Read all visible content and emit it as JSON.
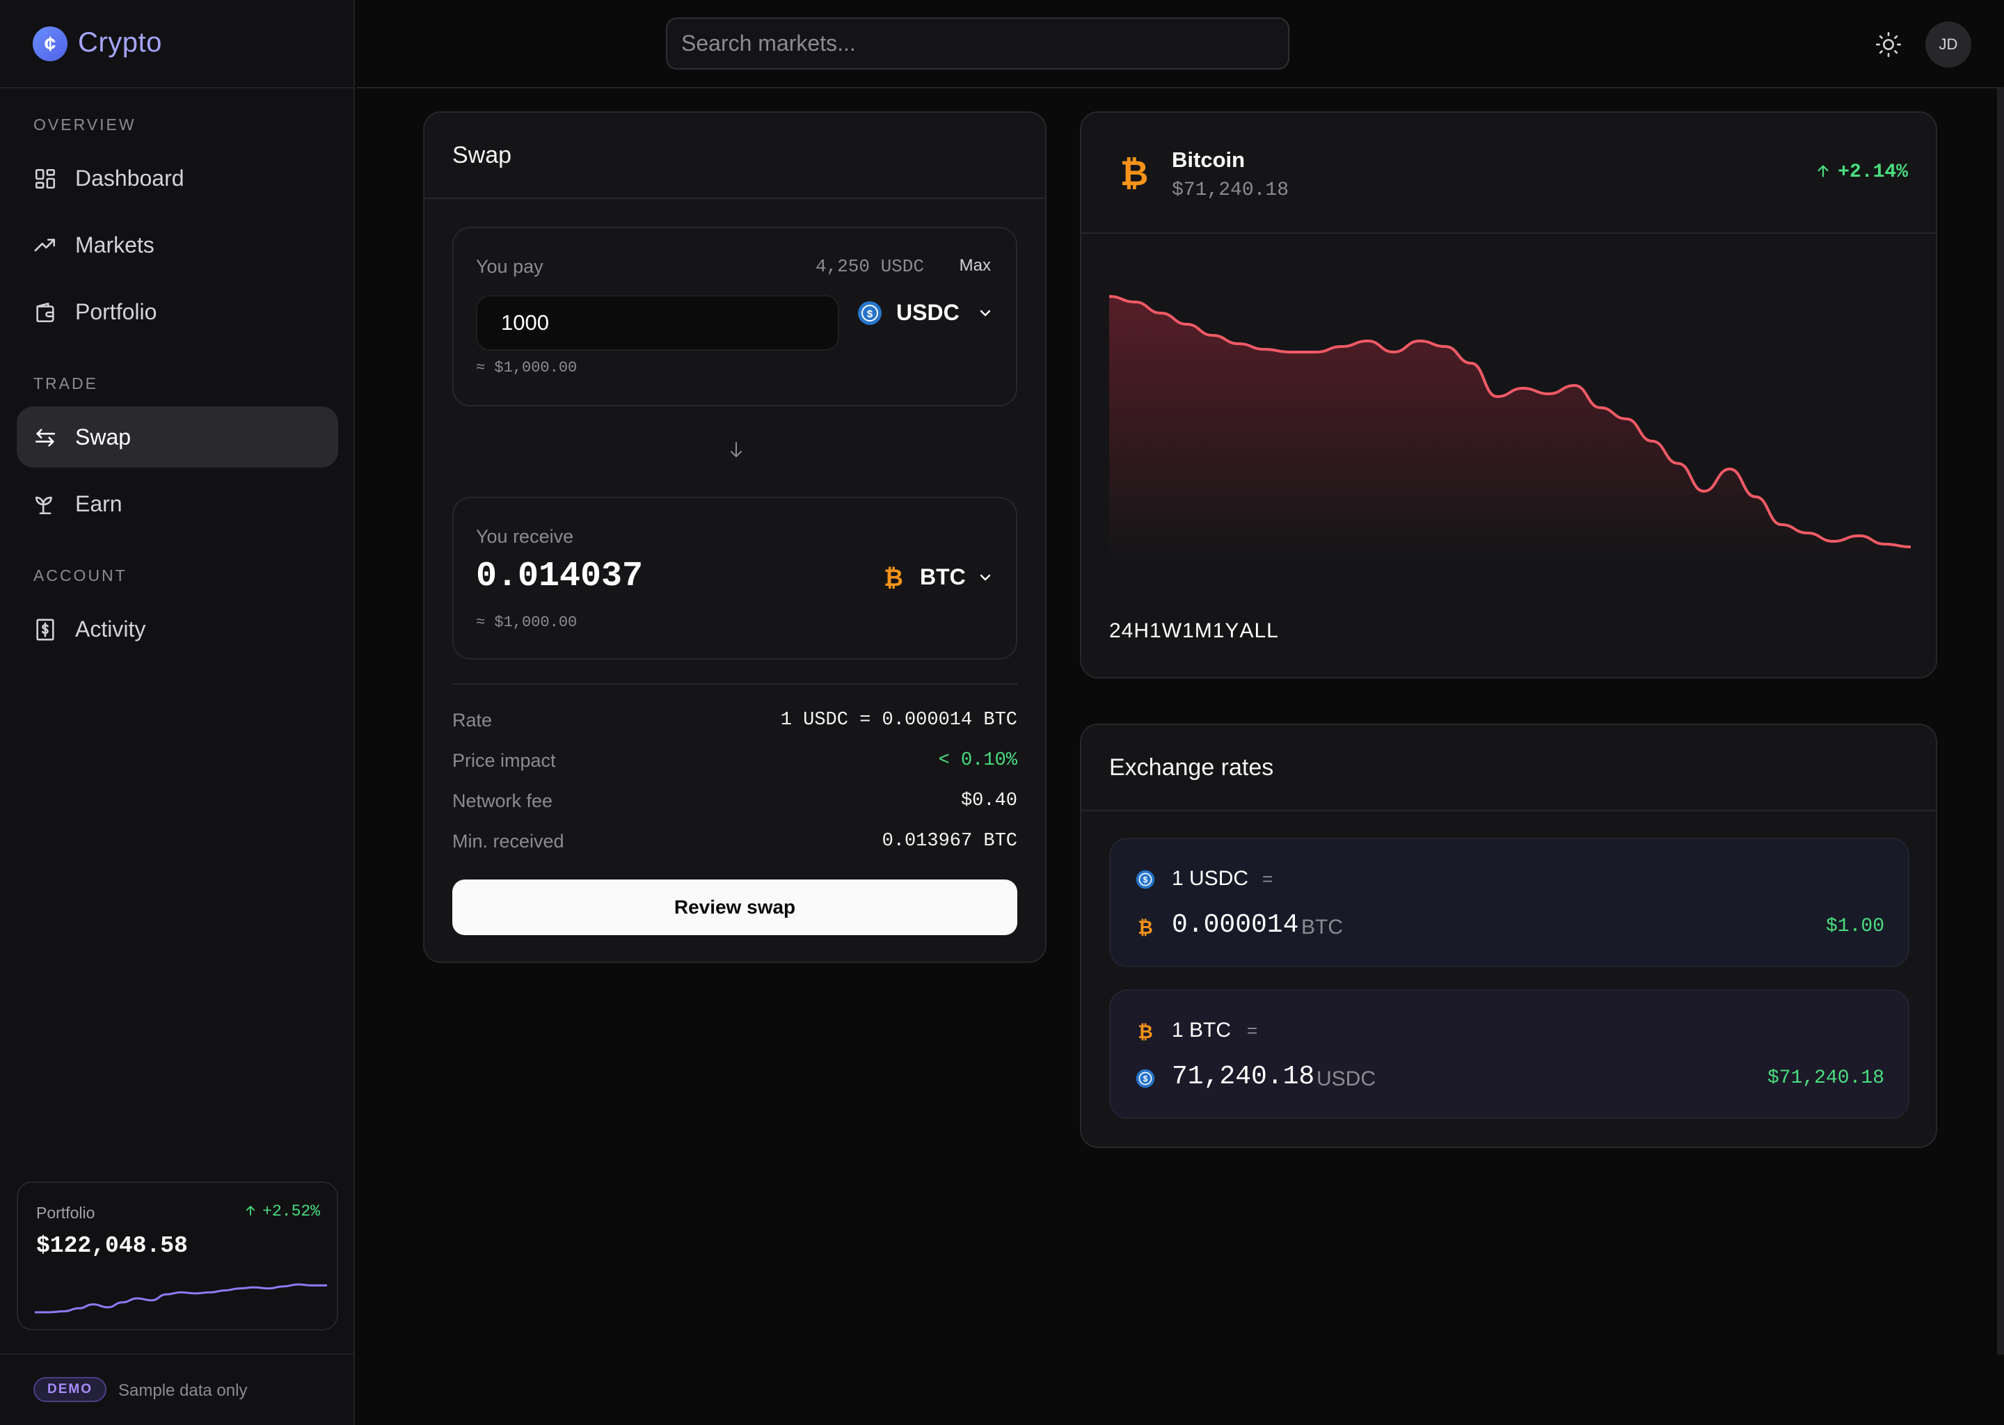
{
  "brand": {
    "name": "Crypto"
  },
  "search": {
    "placeholder": "Search markets..."
  },
  "user": {
    "initials": "JD"
  },
  "sidebar": {
    "sections": [
      "OVERVIEW",
      "TRADE",
      "ACCOUNT"
    ],
    "items": [
      {
        "label": "Dashboard",
        "icon": "dashboard-icon"
      },
      {
        "label": "Markets",
        "icon": "trending-up-icon"
      },
      {
        "label": "Portfolio",
        "icon": "wallet-icon"
      },
      {
        "label": "Swap",
        "icon": "swap-icon",
        "active": true
      },
      {
        "label": "Earn",
        "icon": "sprout-icon"
      },
      {
        "label": "Activity",
        "icon": "receipt-icon"
      }
    ],
    "portfolio": {
      "label": "Portfolio",
      "change": "+2.52%",
      "value": "$122,048.58",
      "sparkline": [
        20,
        20,
        21,
        24,
        28,
        25,
        30,
        34,
        32,
        38,
        40,
        39,
        40,
        42,
        44,
        45,
        44,
        46,
        48,
        47,
        47
      ]
    },
    "demo": {
      "badge": "DEMO",
      "note": "Sample data only"
    }
  },
  "swap": {
    "title": "Swap",
    "pay": {
      "label": "You pay",
      "balance": "4,250 USDC",
      "max_label": "Max",
      "amount": "1000",
      "token": "USDC",
      "approx": "≈ $1,000.00"
    },
    "receive": {
      "label": "You receive",
      "amount": "0.014037",
      "token": "BTC",
      "approx": "≈ $1,000.00"
    },
    "details": [
      {
        "key": "Rate",
        "value": "1 USDC = 0.000014 BTC",
        "positive": false
      },
      {
        "key": "Price impact",
        "value": "< 0.10%",
        "positive": true
      },
      {
        "key": "Network fee",
        "value": "$0.40",
        "positive": false
      },
      {
        "key": "Min. received",
        "value": "0.013967 BTC",
        "positive": false
      }
    ],
    "cta": "Review swap"
  },
  "coin": {
    "name": "Bitcoin",
    "price": "$71,240.18",
    "change": "+2.14%",
    "ranges": [
      "24H",
      "1W",
      "1M",
      "1Y",
      "ALL"
    ]
  },
  "chart_data": {
    "type": "area",
    "title": "",
    "xlabel": "",
    "ylabel": "",
    "series": [
      {
        "values": [
          100,
          98,
          94,
          90,
          86,
          83,
          81,
          80,
          80,
          82,
          84,
          80,
          84,
          82,
          76,
          64,
          67,
          65,
          68,
          60,
          56,
          48,
          40,
          30,
          38,
          28,
          18,
          15,
          12,
          14,
          11,
          10
        ]
      }
    ],
    "colors": {
      "line": "#f05a66",
      "fill": "#5a1f28"
    }
  },
  "rates": {
    "title": "Exchange rates",
    "cards": [
      {
        "from": "1 USDC",
        "eq": "=",
        "to_value": "0.000014",
        "to_symbol": "BTC",
        "usd": "$1.00",
        "from_icon": "usdc-icon",
        "to_icon": "bitcoin-icon"
      },
      {
        "from": "1 BTC",
        "eq": "=",
        "to_value": "71,240.18",
        "to_symbol": "USDC",
        "usd": "$71,240.18",
        "from_icon": "bitcoin-icon",
        "to_icon": "usdc-icon"
      }
    ]
  },
  "colors": {
    "accent": "#a4a5f7",
    "positive": "#4ade80",
    "bitcoin": "#f7931a",
    "usdc": "#2775ca",
    "chart_line": "#f05a66"
  }
}
